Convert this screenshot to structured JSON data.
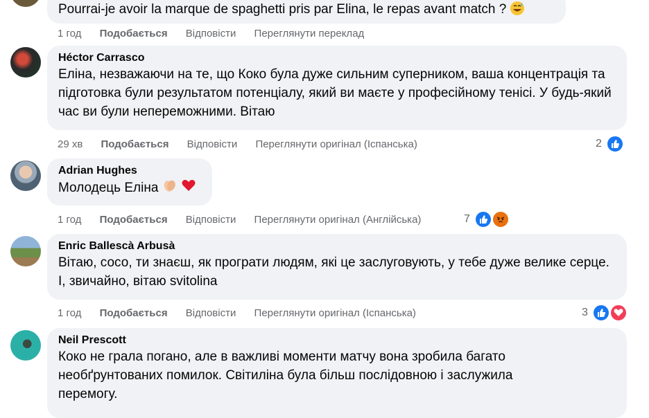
{
  "comments": [
    {
      "author": "",
      "text": "Pourrai-je avoir la marque de spaghetti pris par Elina, le repas avant match ?",
      "time": "1 год",
      "like": "Подобається",
      "reply": "Відповісти",
      "translate": "Переглянути переклад",
      "reactions_count": ""
    },
    {
      "author": "Héctor Carrasco",
      "text": "Еліна, незважаючи на те, що Коко була дуже сильним суперником, ваша концентрація та підготовка були результатом потенціалу, який ви маєте у професійному тенісі. У будь-який час ви були непереможними. Вітаю",
      "time": "29 хв",
      "like": "Подобається",
      "reply": "Відповісти",
      "translate": "Переглянути оригінал (Іспанська)",
      "reactions_count": "2"
    },
    {
      "author": "Adrian Hughes",
      "text": "Молодець Еліна",
      "time": "1 год",
      "like": "Подобається",
      "reply": "Відповісти",
      "translate": "Переглянути оригінал (Англійська)",
      "reactions_count": "7"
    },
    {
      "author": "Enric Ballescà Arbusà",
      "text": "Вітаю, сосо, ти знаєш, як програти людям, які це заслуговують, у тебе дуже велике серце. І, звичайно, вітаю svitolina",
      "time": "1 год",
      "like": "Подобається",
      "reply": "Відповісти",
      "translate": "Переглянути оригінал (Іспанська)",
      "reactions_count": "3"
    },
    {
      "author": "Neil Prescott",
      "text": "Коко не грала погано, але в важливі моменти матчу вона зробила багато необґрунтованих помилок. Світиліна була більш послідовною і заслужила перемогу.",
      "time": "",
      "like": "",
      "reply": "",
      "translate": "",
      "reactions_count": ""
    }
  ],
  "icons": {
    "like": "like-reaction-icon",
    "love": "love-reaction-icon",
    "angry": "angry-reaction-icon"
  },
  "colors": {
    "bubble": "#f0f2f5",
    "meta": "#65676b",
    "like_blue": "#1877f2",
    "love_red": "#f33e58"
  }
}
